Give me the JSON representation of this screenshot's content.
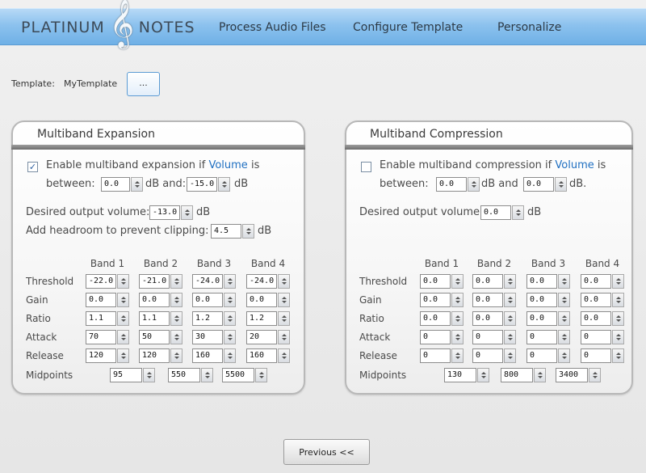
{
  "app": {
    "logo_left": "PLATINUM",
    "logo_right": "NOTES"
  },
  "nav": [
    "Process Audio Files",
    "Configure Template",
    "Personalize"
  ],
  "template": {
    "label": "Template:",
    "name": "MyTemplate",
    "browse_label": "..."
  },
  "expansion": {
    "title": "Multiband Expansion",
    "enabled": true,
    "check_mark": "✓",
    "enable_text_a": "Enable multiband expansion if",
    "enable_text_link": "Volume",
    "enable_text_b": "is",
    "between_label": "between:",
    "low": "0.0",
    "and_label": "dB and:",
    "high": "-15.0",
    "db_unit": "dB",
    "desired_label": "Desired output volume:",
    "desired_value": "-13.0",
    "headroom_label": "Add headroom to prevent clipping:",
    "headroom_value": "4.5",
    "bands": [
      "Band 1",
      "Band 2",
      "Band 3",
      "Band 4"
    ],
    "rows": [
      {
        "label": "Threshold",
        "values": [
          "-22.0",
          "-21.0",
          "-24.0",
          "-24.0"
        ]
      },
      {
        "label": "Gain",
        "values": [
          "0.0",
          "0.0",
          "0.0",
          "0.0"
        ]
      },
      {
        "label": "Ratio",
        "values": [
          "1.1",
          "1.1",
          "1.2",
          "1.2"
        ]
      },
      {
        "label": "Attack",
        "values": [
          "70",
          "50",
          "30",
          "20"
        ]
      },
      {
        "label": "Release",
        "values": [
          "120",
          "120",
          "160",
          "160"
        ]
      }
    ],
    "midpoints_label": "Midpoints",
    "midpoints": [
      "95",
      "550",
      "5500"
    ]
  },
  "compression": {
    "title": "Multiband Compression",
    "enabled": false,
    "enable_text_a": "Enable multiband compression if",
    "enable_text_link": "Volume",
    "enable_text_b": "is",
    "between_label": "between:",
    "low": "0.0",
    "and_label": "dB and",
    "high": "0.0",
    "db_unit": "dB.",
    "desired_label": "Desired output volume:",
    "desired_value": "0.0",
    "desired_unit": "dB",
    "bands": [
      "Band 1",
      "Band 2",
      "Band 3",
      "Band 4"
    ],
    "rows": [
      {
        "label": "Threshold",
        "values": [
          "0.0",
          "0.0",
          "0.0",
          "0.0"
        ]
      },
      {
        "label": "Gain",
        "values": [
          "0.0",
          "0.0",
          "0.0",
          "0.0"
        ]
      },
      {
        "label": "Ratio",
        "values": [
          "0.0",
          "0.0",
          "0.0",
          "0.0"
        ]
      },
      {
        "label": "Attack",
        "values": [
          "0",
          "0",
          "0",
          "0"
        ]
      },
      {
        "label": "Release",
        "values": [
          "0",
          "0",
          "0",
          "0"
        ]
      }
    ],
    "midpoints_label": "Midpoints",
    "midpoints": [
      "130",
      "800",
      "3400"
    ]
  },
  "footer": {
    "previous_label": "Previous <<"
  },
  "colors": {
    "header": "#8cc2ee",
    "link": "#1f6fc1",
    "panel_bar": "#7a7a7a"
  }
}
